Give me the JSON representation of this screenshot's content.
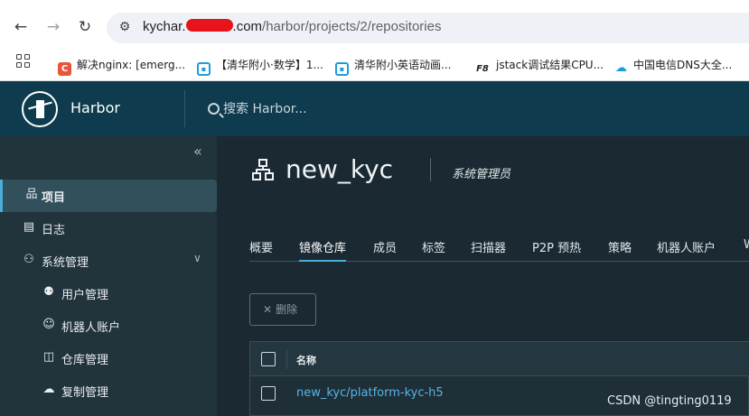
{
  "browser": {
    "url_host_start": "kychar.",
    "url_host_end": ".com",
    "url_path": "/harbor/projects/2/repositories",
    "bookmarks": [
      {
        "label": "解决nginx: [emerg...",
        "icon": "C",
        "color": "#e8553a"
      },
      {
        "label": "【清华附小·数学】1...",
        "icon": "tv",
        "color": "#1e9be0"
      },
      {
        "label": "清华附小英语动画...",
        "icon": "tv",
        "color": "#1e9be0"
      },
      {
        "label": "jstack调试结果CPU...",
        "icon": "F8",
        "color": "#202124"
      },
      {
        "label": "中国电信DNS大全...",
        "icon": "cloud",
        "color": "#1e9be0"
      }
    ]
  },
  "header": {
    "brand": "Harbor",
    "search_placeholder": "搜索 Harbor..."
  },
  "sidebar": {
    "items": [
      {
        "label": "项目",
        "icon": "project-icon",
        "active": true
      },
      {
        "label": "日志",
        "icon": "log-icon"
      },
      {
        "label": "系统管理",
        "icon": "admin-icon",
        "expanded": true
      },
      {
        "label": "用户管理",
        "icon": "users-icon",
        "sub": true
      },
      {
        "label": "机器人账户",
        "icon": "robot-icon",
        "sub": true
      },
      {
        "label": "仓库管理",
        "icon": "registry-icon",
        "sub": true
      },
      {
        "label": "复制管理",
        "icon": "replication-icon",
        "sub": true
      }
    ]
  },
  "project": {
    "name": "new_kyc",
    "role": "系统管理员"
  },
  "tabs": [
    "概要",
    "镜像仓库",
    "成员",
    "标签",
    "扫描器",
    "P2P 预热",
    "策略",
    "机器人账户",
    "W"
  ],
  "active_tab": "镜像仓库",
  "toolbar": {
    "delete_label": "删除"
  },
  "table": {
    "header_name": "名称",
    "rows": [
      {
        "name": "new_kyc/platform-kyc-h5"
      }
    ]
  },
  "watermark": "CSDN @tingting0119",
  "colors": {
    "header_bg": "#0e3b4d",
    "sidebar_bg": "#21333b",
    "main_bg": "#1b2a32",
    "accent": "#49aeda",
    "link": "#57b4e6"
  }
}
